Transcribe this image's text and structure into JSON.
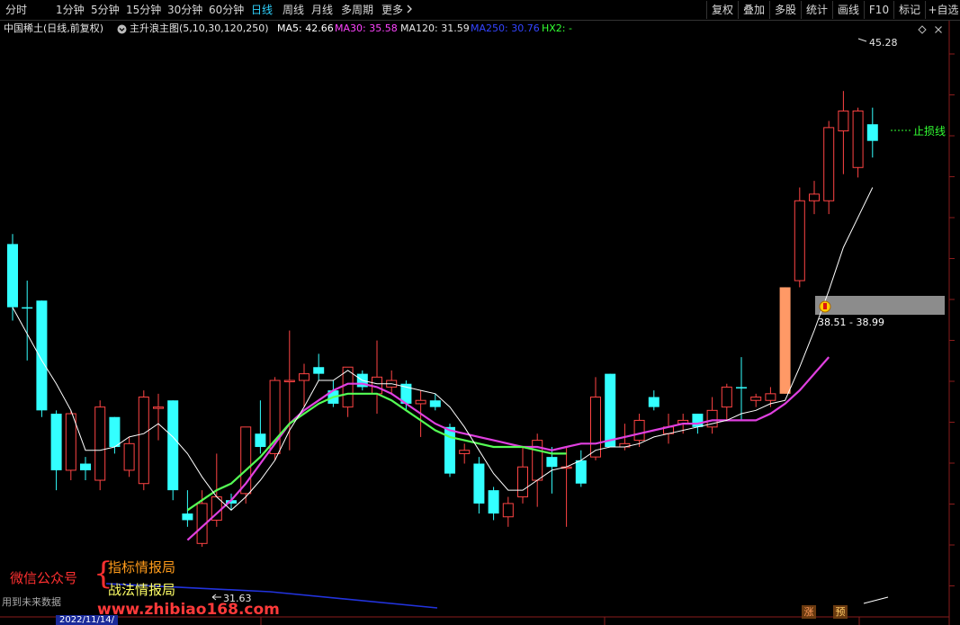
{
  "toolbar": {
    "tabs": [
      {
        "label": "分时",
        "active": false
      },
      {
        "label": "1分钟",
        "active": false
      },
      {
        "label": "5分钟",
        "active": false
      },
      {
        "label": "15分钟",
        "active": false
      },
      {
        "label": "30分钟",
        "active": false
      },
      {
        "label": "60分钟",
        "active": false
      },
      {
        "label": "日线",
        "active": true
      },
      {
        "label": "周线",
        "active": false
      },
      {
        "label": "月线",
        "active": false
      },
      {
        "label": "多周期",
        "active": false
      },
      {
        "label": "更多",
        "active": false
      }
    ],
    "more_icon": "chevron-right-icon",
    "right_tools": [
      "复权",
      "叠加",
      "多股",
      "统计",
      "画线",
      "F10",
      "标记",
      "+自选"
    ]
  },
  "info": {
    "stock": "中国稀土(日线,前复权)",
    "indicator": "主升浪主图(5,10,30,120,250)",
    "ma5": "MA5: 42.66",
    "ma30": "MA30: 35.58",
    "ma120": "MA120: 31.59",
    "ma250": "MA250: 30.76",
    "hx2": "HX2: -"
  },
  "colors": {
    "up": "#ff4444",
    "down": "#33ffff",
    "ma5": "#ffffff",
    "ma30": "#e040e0",
    "ma10": "#55ff55",
    "ma250": "#2233dd",
    "stop_line": "#33ff33",
    "orange_bar": "#ff9966",
    "zone": "#8c8c8c",
    "watermark_red": "#ff3030",
    "watermark_orange": "#ff9b1a",
    "watermark_yellow": "#ffff66",
    "url": "#ff3a3a"
  },
  "annotations": {
    "high": "45.28",
    "low": "31.63",
    "stop_line": "止损线",
    "zone": "38.51 - 38.99",
    "bottom_left": "用到未来数据",
    "date": "2022/11/14/",
    "zhang": "涨",
    "yu": "预"
  },
  "watermark": {
    "wechat": "微信公众号",
    "brace": "{",
    "line1": "指标情报局",
    "line2": "战法情报局",
    "url": "www.zhibiao168.com"
  },
  "chart_data": {
    "type": "candlestick",
    "ylim": [
      29.6,
      46.9
    ],
    "candles": [
      {
        "o": 40.7,
        "h": 41.0,
        "l": 38.4,
        "c": 38.8,
        "dir": "down"
      },
      {
        "o": 38.8,
        "h": 39.6,
        "l": 37.2,
        "c": 38.8,
        "dir": "down"
      },
      {
        "o": 39.0,
        "h": 39.0,
        "l": 35.5,
        "c": 35.7,
        "dir": "down"
      },
      {
        "o": 35.6,
        "h": 35.7,
        "l": 33.3,
        "c": 33.9,
        "dir": "down"
      },
      {
        "o": 33.9,
        "h": 35.7,
        "l": 33.6,
        "c": 35.6,
        "dir": "up"
      },
      {
        "o": 34.1,
        "h": 34.3,
        "l": 33.6,
        "c": 33.9,
        "dir": "down"
      },
      {
        "o": 33.6,
        "h": 36.0,
        "l": 33.3,
        "c": 35.8,
        "dir": "up"
      },
      {
        "o": 35.5,
        "h": 35.5,
        "l": 34.4,
        "c": 34.6,
        "dir": "down"
      },
      {
        "o": 33.9,
        "h": 34.9,
        "l": 33.7,
        "c": 34.7,
        "dir": "up"
      },
      {
        "o": 33.5,
        "h": 36.3,
        "l": 33.3,
        "c": 36.1,
        "dir": "up"
      },
      {
        "o": 35.8,
        "h": 36.2,
        "l": 34.8,
        "c": 35.8,
        "dir": "up"
      },
      {
        "o": 36.0,
        "h": 36.0,
        "l": 33.0,
        "c": 33.3,
        "dir": "down"
      },
      {
        "o": 32.6,
        "h": 33.3,
        "l": 32.2,
        "c": 32.4,
        "dir": "down"
      },
      {
        "o": 31.7,
        "h": 33.3,
        "l": 31.6,
        "c": 32.9,
        "dir": "up"
      },
      {
        "o": 32.4,
        "h": 34.4,
        "l": 32.2,
        "c": 33.1,
        "dir": "up"
      },
      {
        "o": 32.9,
        "h": 33.2,
        "l": 32.7,
        "c": 33.0,
        "dir": "down"
      },
      {
        "o": 33.2,
        "h": 35.2,
        "l": 32.9,
        "c": 35.2,
        "dir": "up"
      },
      {
        "o": 35.0,
        "h": 36.0,
        "l": 34.4,
        "c": 34.6,
        "dir": "down"
      },
      {
        "o": 34.4,
        "h": 36.7,
        "l": 34.2,
        "c": 36.6,
        "dir": "up"
      },
      {
        "o": 36.6,
        "h": 38.1,
        "l": 34.5,
        "c": 36.6,
        "dir": "up"
      },
      {
        "o": 36.6,
        "h": 37.1,
        "l": 35.8,
        "c": 36.8,
        "dir": "up"
      },
      {
        "o": 37.0,
        "h": 37.4,
        "l": 36.6,
        "c": 36.8,
        "dir": "down"
      },
      {
        "o": 36.3,
        "h": 36.6,
        "l": 35.8,
        "c": 35.9,
        "dir": "down"
      },
      {
        "o": 35.8,
        "h": 37.0,
        "l": 35.5,
        "c": 37.0,
        "dir": "up"
      },
      {
        "o": 36.8,
        "h": 36.9,
        "l": 36.3,
        "c": 36.4,
        "dir": "down"
      },
      {
        "o": 36.2,
        "h": 37.8,
        "l": 35.6,
        "c": 36.7,
        "dir": "up"
      },
      {
        "o": 36.6,
        "h": 36.9,
        "l": 36.2,
        "c": 36.4,
        "dir": "up"
      },
      {
        "o": 36.5,
        "h": 36.6,
        "l": 35.7,
        "c": 35.9,
        "dir": "down"
      },
      {
        "o": 36.0,
        "h": 36.3,
        "l": 34.9,
        "c": 35.9,
        "dir": "up"
      },
      {
        "o": 36.0,
        "h": 36.2,
        "l": 35.7,
        "c": 35.8,
        "dir": "down"
      },
      {
        "o": 35.2,
        "h": 35.3,
        "l": 33.7,
        "c": 33.8,
        "dir": "down"
      },
      {
        "o": 34.4,
        "h": 34.7,
        "l": 34.1,
        "c": 34.5,
        "dir": "up"
      },
      {
        "o": 34.1,
        "h": 34.3,
        "l": 32.6,
        "c": 32.9,
        "dir": "down"
      },
      {
        "o": 33.3,
        "h": 33.4,
        "l": 32.4,
        "c": 32.6,
        "dir": "down"
      },
      {
        "o": 32.5,
        "h": 33.1,
        "l": 32.2,
        "c": 32.9,
        "dir": "up"
      },
      {
        "o": 33.1,
        "h": 34.6,
        "l": 32.9,
        "c": 34.0,
        "dir": "up"
      },
      {
        "o": 33.6,
        "h": 35.0,
        "l": 32.8,
        "c": 34.8,
        "dir": "up"
      },
      {
        "o": 34.3,
        "h": 34.6,
        "l": 33.2,
        "c": 34.0,
        "dir": "down"
      },
      {
        "o": 34.0,
        "h": 34.6,
        "l": 32.2,
        "c": 34.0,
        "dir": "up"
      },
      {
        "o": 34.2,
        "h": 34.5,
        "l": 33.4,
        "c": 33.5,
        "dir": "down"
      },
      {
        "o": 34.3,
        "h": 36.7,
        "l": 34.2,
        "c": 36.1,
        "dir": "up"
      },
      {
        "o": 36.8,
        "h": 36.8,
        "l": 34.6,
        "c": 34.6,
        "dir": "down"
      },
      {
        "o": 34.6,
        "h": 35.3,
        "l": 34.5,
        "c": 34.7,
        "dir": "up"
      },
      {
        "o": 34.8,
        "h": 35.6,
        "l": 34.6,
        "c": 35.4,
        "dir": "up"
      },
      {
        "o": 36.1,
        "h": 36.3,
        "l": 35.7,
        "c": 35.8,
        "dir": "down"
      },
      {
        "o": 35.0,
        "h": 35.6,
        "l": 34.7,
        "c": 35.2,
        "dir": "up"
      },
      {
        "o": 35.3,
        "h": 35.6,
        "l": 35.0,
        "c": 35.4,
        "dir": "up"
      },
      {
        "o": 35.6,
        "h": 35.6,
        "l": 35.0,
        "c": 35.2,
        "dir": "down"
      },
      {
        "o": 35.2,
        "h": 36.1,
        "l": 35.0,
        "c": 35.7,
        "dir": "up"
      },
      {
        "o": 35.8,
        "h": 36.5,
        "l": 35.4,
        "c": 36.4,
        "dir": "up"
      },
      {
        "o": 36.4,
        "h": 37.3,
        "l": 35.4,
        "c": 36.4,
        "dir": "down"
      },
      {
        "o": 36.0,
        "h": 36.2,
        "l": 35.8,
        "c": 36.1,
        "dir": "up"
      },
      {
        "o": 36.0,
        "h": 36.4,
        "l": 35.8,
        "c": 36.2,
        "dir": "up"
      },
      {
        "o": 36.2,
        "h": 39.4,
        "l": 36.2,
        "c": 39.4,
        "dir": "up",
        "special": true
      },
      {
        "o": 39.6,
        "h": 42.4,
        "l": 39.4,
        "c": 42.0,
        "dir": "up"
      },
      {
        "o": 42.0,
        "h": 42.6,
        "l": 41.6,
        "c": 42.2,
        "dir": "up"
      },
      {
        "o": 42.0,
        "h": 44.4,
        "l": 41.6,
        "c": 44.2,
        "dir": "up"
      },
      {
        "o": 44.1,
        "h": 45.3,
        "l": 42.8,
        "c": 44.7,
        "dir": "up"
      },
      {
        "o": 44.7,
        "h": 44.8,
        "l": 42.7,
        "c": 43.0,
        "dir": "up"
      },
      {
        "o": 44.3,
        "h": 44.8,
        "l": 43.3,
        "c": 43.8,
        "dir": "down"
      }
    ],
    "ma5": [
      38.8,
      38.0,
      37.2,
      36.5,
      35.7,
      34.5,
      34.5,
      34.6,
      34.9,
      35.0,
      35.3,
      34.9,
      34.4,
      33.7,
      33.1,
      32.7,
      33.1,
      33.6,
      34.2,
      35.1,
      35.8,
      36.6,
      36.6,
      36.9,
      36.6,
      36.5,
      36.5,
      36.4,
      36.3,
      36.2,
      35.8,
      35.2,
      34.5,
      33.8,
      33.3,
      33.3,
      33.6,
      33.9,
      34.0,
      34.2,
      34.5,
      34.6,
      34.6,
      34.7,
      34.9,
      35.0,
      35.1,
      35.2,
      35.3,
      35.4,
      35.6,
      35.7,
      35.9,
      36.0,
      37.0,
      38.1,
      39.3,
      40.6,
      41.5,
      42.4
    ],
    "ma10_green": [
      null,
      null,
      null,
      null,
      null,
      null,
      null,
      null,
      null,
      null,
      null,
      null,
      32.7,
      33.0,
      33.3,
      33.5,
      33.9,
      34.3,
      34.8,
      35.3,
      35.6,
      35.9,
      36.1,
      36.2,
      36.2,
      36.2,
      36.0,
      35.7,
      35.4,
      35.1,
      34.9,
      34.8,
      34.7,
      34.6,
      34.6,
      34.6,
      34.5,
      34.4,
      34.4
    ],
    "ma30": [
      null,
      null,
      null,
      null,
      null,
      null,
      null,
      null,
      null,
      null,
      null,
      null,
      31.8,
      32.2,
      32.6,
      33.0,
      33.5,
      34.1,
      34.7,
      35.3,
      35.7,
      36.0,
      36.3,
      36.5,
      36.5,
      36.4,
      36.2,
      35.9,
      35.6,
      35.3,
      35.1,
      35.0,
      34.9,
      34.8,
      34.7,
      34.6,
      34.6,
      34.5,
      34.6,
      34.7,
      34.7,
      34.8,
      34.9,
      35.0,
      35.1,
      35.2,
      35.3,
      35.3,
      35.4,
      35.4,
      35.4,
      35.4,
      35.6,
      35.9,
      36.3,
      36.8,
      37.3
    ],
    "ma250": [
      31.0,
      30.6,
      30.2
    ],
    "high_label": "45.28",
    "low_label": "31.63",
    "zone_range": [
      38.51,
      38.99
    ]
  }
}
